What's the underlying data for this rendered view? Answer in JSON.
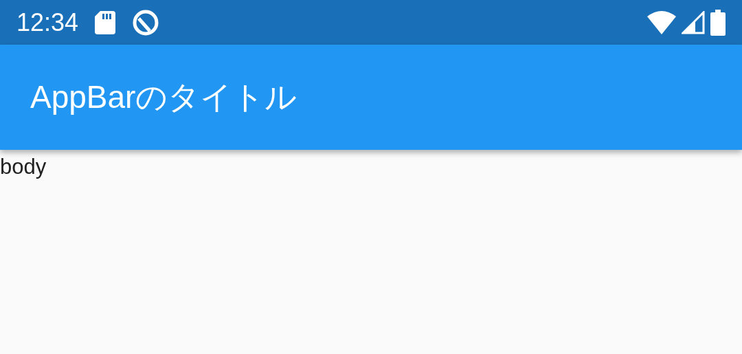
{
  "status_bar": {
    "time": "12:34"
  },
  "app_bar": {
    "title": "AppBarのタイトル"
  },
  "body": {
    "text": "body"
  }
}
